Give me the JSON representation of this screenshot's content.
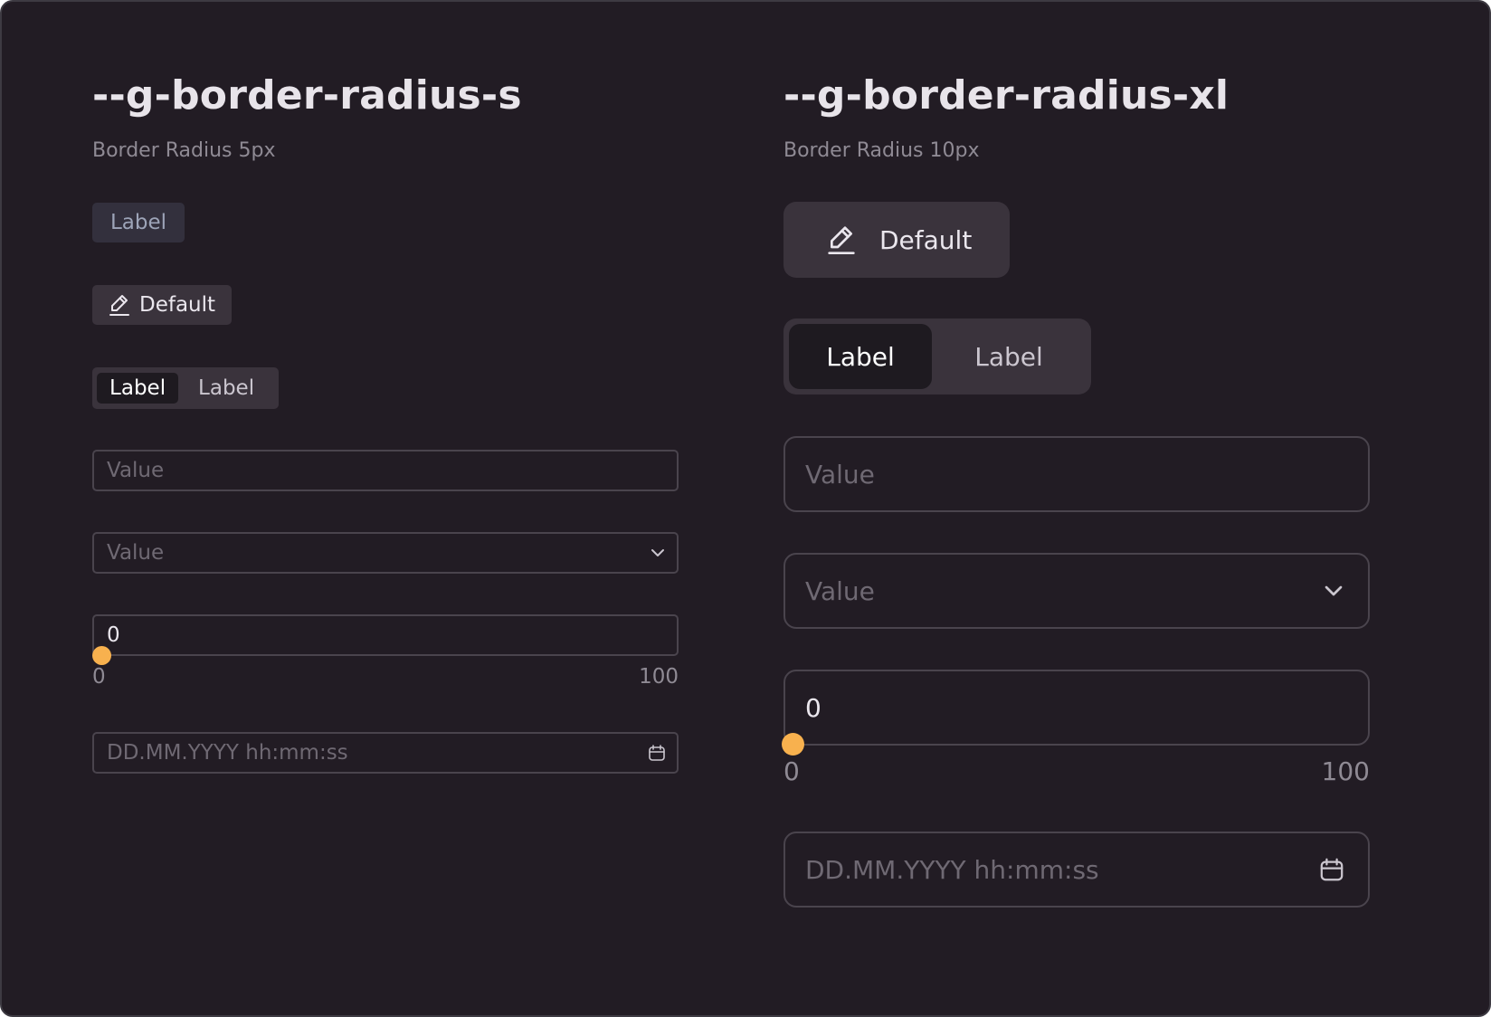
{
  "left": {
    "title": "--g-border-radius-s",
    "subtitle": "Border Radius 5px",
    "label_chip": "Label",
    "button": {
      "label": "Default",
      "icon": "pencil-icon"
    },
    "segmented": {
      "items": [
        "Label",
        "Label"
      ],
      "active_index": 0
    },
    "text_input": {
      "placeholder": "Value"
    },
    "select": {
      "placeholder": "Value",
      "icon": "chevron-down-icon"
    },
    "slider": {
      "value": "0",
      "min": "0",
      "max": "100",
      "fraction": 0
    },
    "datetime": {
      "placeholder": "DD.MM.YYYY hh:mm:ss",
      "icon": "calendar-icon"
    }
  },
  "right": {
    "title": "--g-border-radius-xl",
    "subtitle": "Border Radius 10px",
    "button": {
      "label": "Default",
      "icon": "pencil-icon"
    },
    "segmented": {
      "items": [
        "Label",
        "Label"
      ],
      "active_index": 0
    },
    "text_input": {
      "placeholder": "Value"
    },
    "select": {
      "placeholder": "Value",
      "icon": "chevron-down-icon"
    },
    "slider": {
      "value": "0",
      "min": "0",
      "max": "100",
      "fraction": 0
    },
    "datetime": {
      "placeholder": "DD.MM.YYYY hh:mm:ss",
      "icon": "calendar-icon"
    }
  },
  "colors": {
    "background": "#221c24",
    "surface": "#3a333c",
    "active_segment": "#1e1a20",
    "border": "#4a444d",
    "accent": "#f8b14e",
    "label_chip_bg": "#33303d",
    "label_chip_text": "#9da4b8"
  }
}
